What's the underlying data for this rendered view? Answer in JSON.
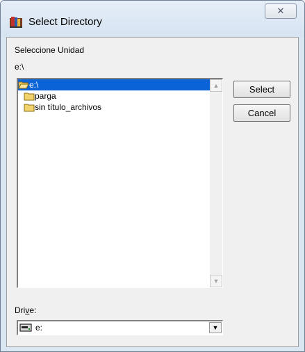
{
  "window": {
    "title": "Select Directory",
    "close_glyph": "✕"
  },
  "labels": {
    "prompt": "Seleccione Unidad",
    "current_path": "e:\\",
    "drive_before": "Dri",
    "drive_mnemonic": "v",
    "drive_after": "e:"
  },
  "directory_list": {
    "items": [
      {
        "label": "e:\\",
        "icon": "open-folder-icon",
        "selected": true
      },
      {
        "label": "parga",
        "icon": "folder-icon",
        "selected": false
      },
      {
        "label": "sin título_archivos",
        "icon": "folder-icon",
        "selected": false
      }
    ]
  },
  "buttons": {
    "select_label": "Select",
    "cancel_label": "Cancel"
  },
  "drive": {
    "value": "e:",
    "icon": "drive-icon"
  },
  "colors": {
    "selection": "#0a64d8",
    "folder": "#f2d36b"
  }
}
